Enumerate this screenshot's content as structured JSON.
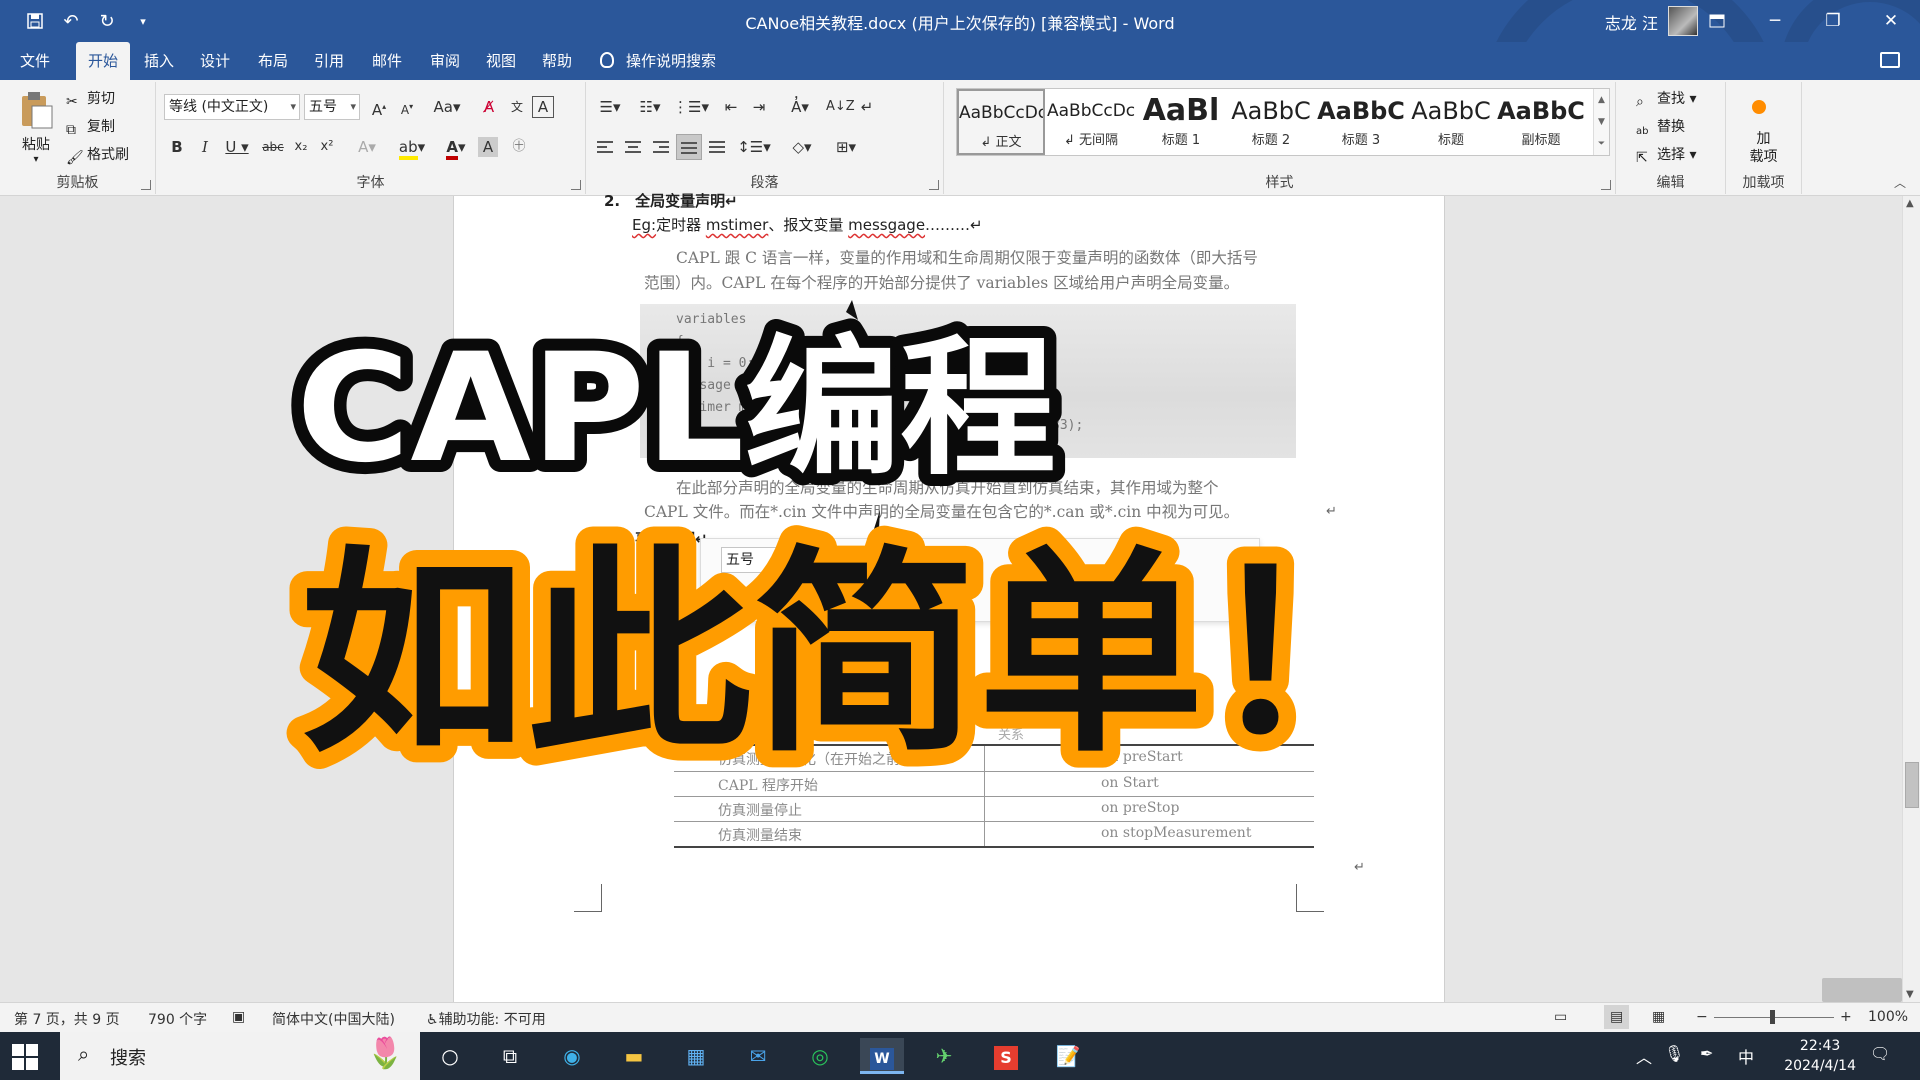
{
  "window": {
    "title": "CANoe相关教程.docx (用户上次保存的) [兼容模式]  -  Word",
    "user": "志龙 汪",
    "controls": [
      "restore-ribbon",
      "minimize",
      "maximize",
      "close"
    ]
  },
  "tabs": [
    "文件",
    "开始",
    "插入",
    "设计",
    "布局",
    "引用",
    "邮件",
    "审阅",
    "视图",
    "帮助"
  ],
  "active_tab": "开始",
  "tell_me": "操作说明搜索",
  "ribbon": {
    "clipboard": {
      "paste": "粘贴",
      "cut": "剪切",
      "copy": "复制",
      "format_painter": "格式刷",
      "label": "剪贴板"
    },
    "font": {
      "name": "等线 (中文正文)",
      "size": "五号",
      "label": "字体"
    },
    "paragraph": {
      "label": "段落"
    },
    "styles": {
      "label": "样式",
      "items": [
        {
          "preview": "AaBbCcDc",
          "name": "↲ 正文"
        },
        {
          "preview": "AaBbCcDc",
          "name": "↲ 无间隔"
        },
        {
          "preview": "AaBl",
          "name": "标题 1"
        },
        {
          "preview": "AaBbC",
          "name": "标题 2"
        },
        {
          "preview": "AaBbC",
          "name": "标题 3"
        },
        {
          "preview": "AaBbC",
          "name": "标题"
        },
        {
          "preview": "AaBbC",
          "name": "副标题"
        }
      ]
    },
    "editing": {
      "find": "查找",
      "replace": "替换",
      "select": "选择",
      "label": "编辑"
    },
    "addins": {
      "button": "加\n载项",
      "label": "加载项"
    }
  },
  "document": {
    "heading2": "2.　全局变量声明↵",
    "eg_prefix": "Eg:",
    "eg_text": "定时器 ",
    "eg_w1": "mstimer",
    "eg_mid": "、报文变量 ",
    "eg_w2": "messgage",
    "eg_tail": "………↵",
    "para1_line1": "CAPL 跟 C 语言一样，变量的作用域和生命周期仅限于变量声明的函数体（即大括号",
    "para1_line2": "范围）内。CAPL 在每个程序的开始部分提供了 variables 区域给用户声明全局变量。",
    "code": [
      "variables",
      "{",
      "  int i = 0;",
      "  message 1",
      "  mstimer m",
      "}"
    ],
    "code_tail": "33);",
    "para2_line1": "在此部分声明的全局变量的生命周期从仿真开始直到仿真结束，其作用域为整个",
    "para2_line2": "CAPL 文件。而在*.cin 文件中声明的全局变量在包含它的*.can 或*.cin 中视为可见。",
    "heading3": "3.　事件处理↵",
    "mini_font": "五号",
    "table_header_hint": "关系",
    "table": [
      [
        "仿真测量初始化（在开始之前）",
        "on preStart"
      ],
      [
        "CAPL 程序开始",
        "on Start"
      ],
      [
        "仿真测量停止",
        "on preStop"
      ],
      [
        "仿真测量结束",
        "on stopMeasurement"
      ]
    ]
  },
  "overlay": {
    "line1": "CAPL编程",
    "line2": "如此简单！"
  },
  "statusbar": {
    "page": "第 7 页，共 9 页",
    "words": "790 个字",
    "language": "简体中文(中国大陆)",
    "accessibility": "辅助功能: 不可用",
    "zoom": "100%"
  },
  "taskbar": {
    "search": "搜索",
    "ime": "中",
    "time": "22:43",
    "date": "2024/4/14"
  }
}
